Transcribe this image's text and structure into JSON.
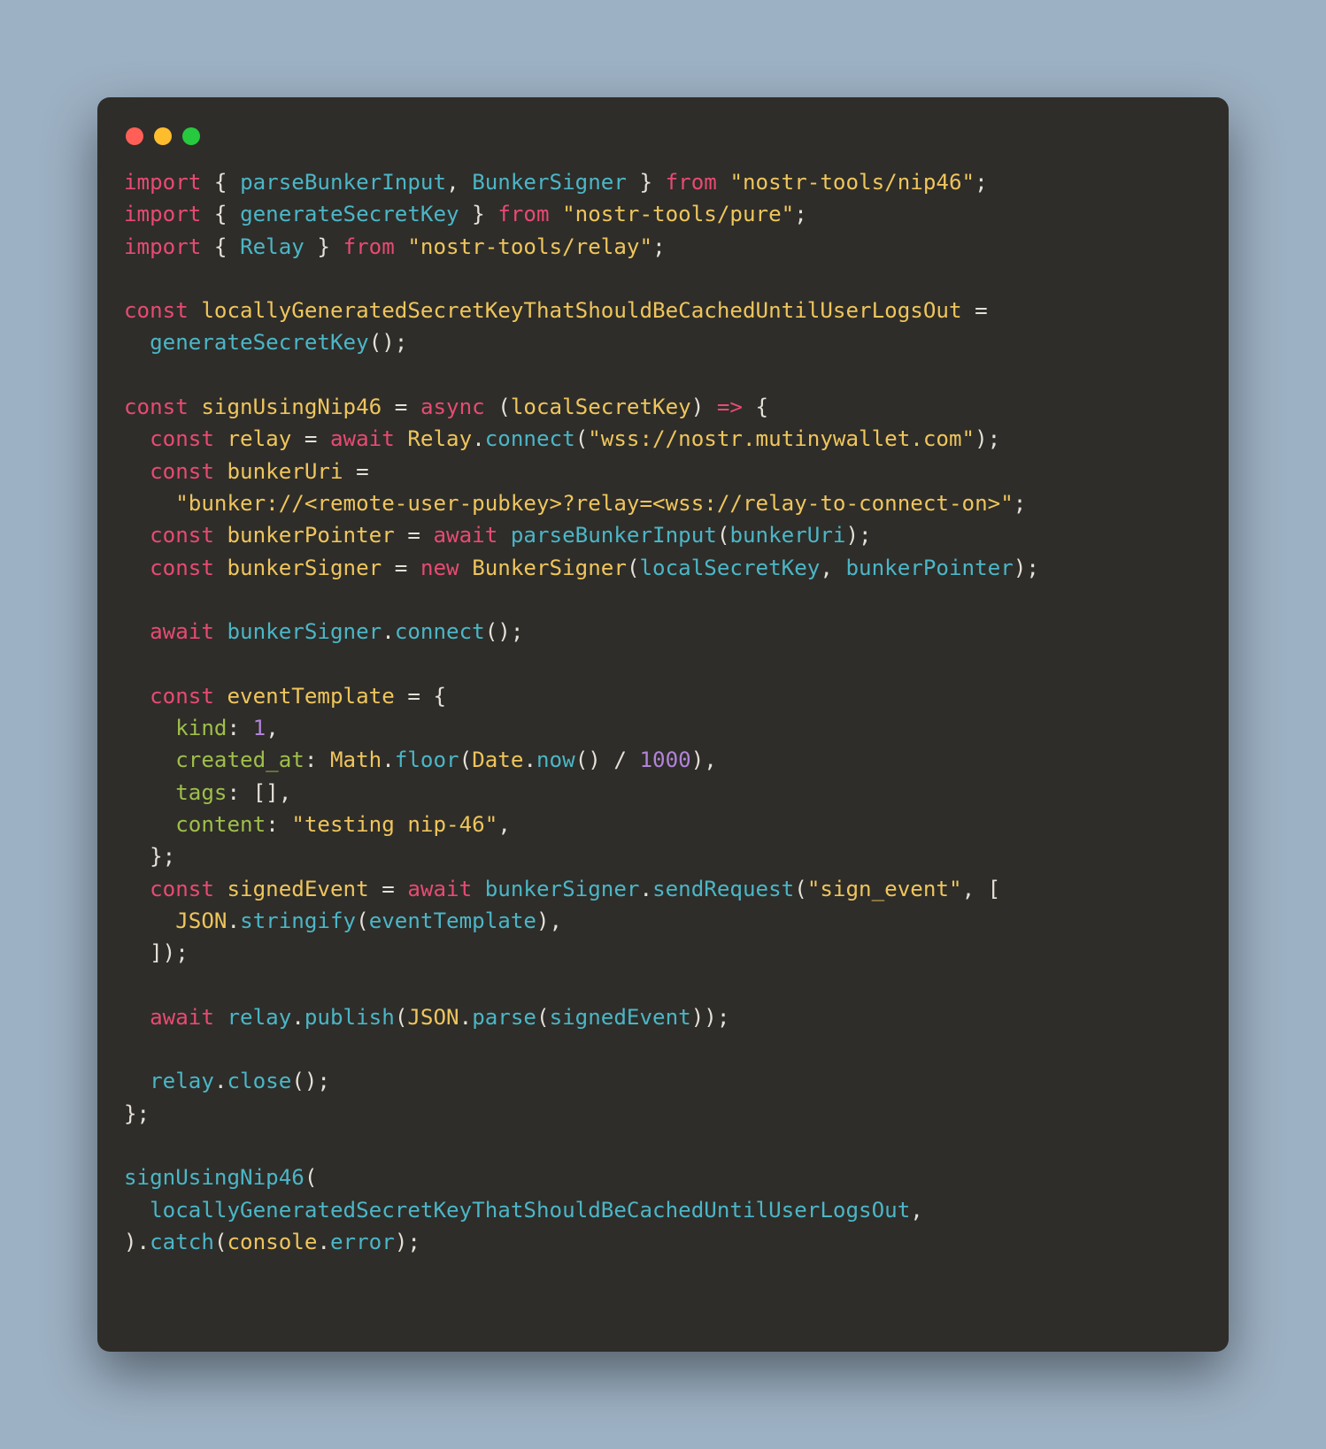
{
  "colors": {
    "background_page": "#9db1c4",
    "background_window": "#2e2d29",
    "dot_red": "#ff5f56",
    "dot_yellow": "#ffbd2e",
    "dot_green": "#27c93f",
    "text_default": "#e5e1d8",
    "keyword": "#e84a72",
    "function": "#4bb6c7",
    "string_yellow": "#efc55c",
    "number": "#b183d9",
    "property": "#9fbf4a",
    "builtin": "#efc55c"
  },
  "code": {
    "line1_import": "import",
    "line1_brace_open": " { ",
    "line1_name1": "parseBunkerInput",
    "line1_comma": ", ",
    "line1_name2": "BunkerSigner",
    "line1_brace_close": " } ",
    "line1_from": "from",
    "line1_sp": " ",
    "line1_str": "\"nostr-tools/nip46\"",
    "line1_semi": ";",
    "line2_import": "import",
    "line2_brace_open": " { ",
    "line2_name1": "generateSecretKey",
    "line2_brace_close": " } ",
    "line2_from": "from",
    "line2_sp": " ",
    "line2_str": "\"nostr-tools/pure\"",
    "line2_semi": ";",
    "line3_import": "import",
    "line3_brace_open": " { ",
    "line3_name1": "Relay",
    "line3_brace_close": " } ",
    "line3_from": "from",
    "line3_sp": " ",
    "line3_str": "\"nostr-tools/relay\"",
    "line3_semi": ";",
    "line5_const": "const",
    "line5_sp": " ",
    "line5_name": "locallyGeneratedSecretKeyThatShouldBeCachedUntilUserLogsOut",
    "line5_eq": " =",
    "line6_indent": "  ",
    "line6_fn": "generateSecretKey",
    "line6_call": "();",
    "line8_const": "const",
    "line8_sp": " ",
    "line8_name": "signUsingNip46",
    "line8_eq": " = ",
    "line8_async": "async",
    "line8_paren_open": " (",
    "line8_param": "localSecretKey",
    "line8_paren_close": ") ",
    "line8_arrow": "=>",
    "line8_brace": " {",
    "line9_indent": "  ",
    "line9_const": "const",
    "line9_sp": " ",
    "line9_name": "relay",
    "line9_eq": " = ",
    "line9_await": "await",
    "line9_sp2": " ",
    "line9_cls": "Relay",
    "line9_dot": ".",
    "line9_fn": "connect",
    "line9_popen": "(",
    "line9_str": "\"wss://nostr.mutinywallet.com\"",
    "line9_pclose": ");",
    "line10_indent": "  ",
    "line10_const": "const",
    "line10_sp": " ",
    "line10_name": "bunkerUri",
    "line10_eq": " =",
    "line11_indent": "    ",
    "line11_str": "\"bunker://<remote-user-pubkey>?relay=<wss://relay-to-connect-on>\"",
    "line11_semi": ";",
    "line12_indent": "  ",
    "line12_const": "const",
    "line12_sp": " ",
    "line12_name": "bunkerPointer",
    "line12_eq": " = ",
    "line12_await": "await",
    "line12_sp2": " ",
    "line12_fn": "parseBunkerInput",
    "line12_popen": "(",
    "line12_arg": "bunkerUri",
    "line12_pclose": ");",
    "line13_indent": "  ",
    "line13_const": "const",
    "line13_sp": " ",
    "line13_name": "bunkerSigner",
    "line13_eq": " = ",
    "line13_new": "new",
    "line13_sp2": " ",
    "line13_cls": "BunkerSigner",
    "line13_popen": "(",
    "line13_arg1": "localSecretKey",
    "line13_comma": ", ",
    "line13_arg2": "bunkerPointer",
    "line13_pclose": ");",
    "line15_indent": "  ",
    "line15_await": "await",
    "line15_sp": " ",
    "line15_obj": "bunkerSigner",
    "line15_dot": ".",
    "line15_fn": "connect",
    "line15_call": "();",
    "line17_indent": "  ",
    "line17_const": "const",
    "line17_sp": " ",
    "line17_name": "eventTemplate",
    "line17_eq": " = {",
    "line18_indent": "    ",
    "line18_key": "kind",
    "line18_colon": ": ",
    "line18_val": "1",
    "line18_comma": ",",
    "line19_indent": "    ",
    "line19_key": "created_at",
    "line19_colon": ": ",
    "line19_math": "Math",
    "line19_dot1": ".",
    "line19_floor": "floor",
    "line19_popen": "(",
    "line19_date": "Date",
    "line19_dot2": ".",
    "line19_now": "now",
    "line19_call": "() / ",
    "line19_num": "1000",
    "line19_pclose": "),",
    "line20_indent": "    ",
    "line20_key": "tags",
    "line20_colon": ": [],",
    "line21_indent": "    ",
    "line21_key": "content",
    "line21_colon": ": ",
    "line21_str": "\"testing nip-46\"",
    "line21_comma": ",",
    "line22_indent": "  ",
    "line22_close": "};",
    "line23_indent": "  ",
    "line23_const": "const",
    "line23_sp": " ",
    "line23_name": "signedEvent",
    "line23_eq": " = ",
    "line23_await": "await",
    "line23_sp2": " ",
    "line23_obj": "bunkerSigner",
    "line23_dot": ".",
    "line23_fn": "sendRequest",
    "line23_popen": "(",
    "line23_str": "\"sign_event\"",
    "line23_comma": ", [",
    "line24_indent": "    ",
    "line24_json": "JSON",
    "line24_dot": ".",
    "line24_fn": "stringify",
    "line24_popen": "(",
    "line24_arg": "eventTemplate",
    "line24_pclose": "),",
    "line25_indent": "  ",
    "line25_close": "]);",
    "line27_indent": "  ",
    "line27_await": "await",
    "line27_sp": " ",
    "line27_obj": "relay",
    "line27_dot": ".",
    "line27_fn": "publish",
    "line27_popen": "(",
    "line27_json": "JSON",
    "line27_dot2": ".",
    "line27_parse": "parse",
    "line27_popen2": "(",
    "line27_arg": "signedEvent",
    "line27_pclose": "));",
    "line29_indent": "  ",
    "line29_obj": "relay",
    "line29_dot": ".",
    "line29_fn": "close",
    "line29_call": "();",
    "line30_close": "};",
    "line32_fn": "signUsingNip46",
    "line32_popen": "(",
    "line33_indent": "  ",
    "line33_arg": "locallyGeneratedSecretKeyThatShouldBeCachedUntilUserLogsOut",
    "line33_comma": ",",
    "line34_pclose": ").",
    "line34_catch": "catch",
    "line34_popen": "(",
    "line34_console": "console",
    "line34_dot": ".",
    "line34_error": "error",
    "line34_pclose2": ");"
  }
}
